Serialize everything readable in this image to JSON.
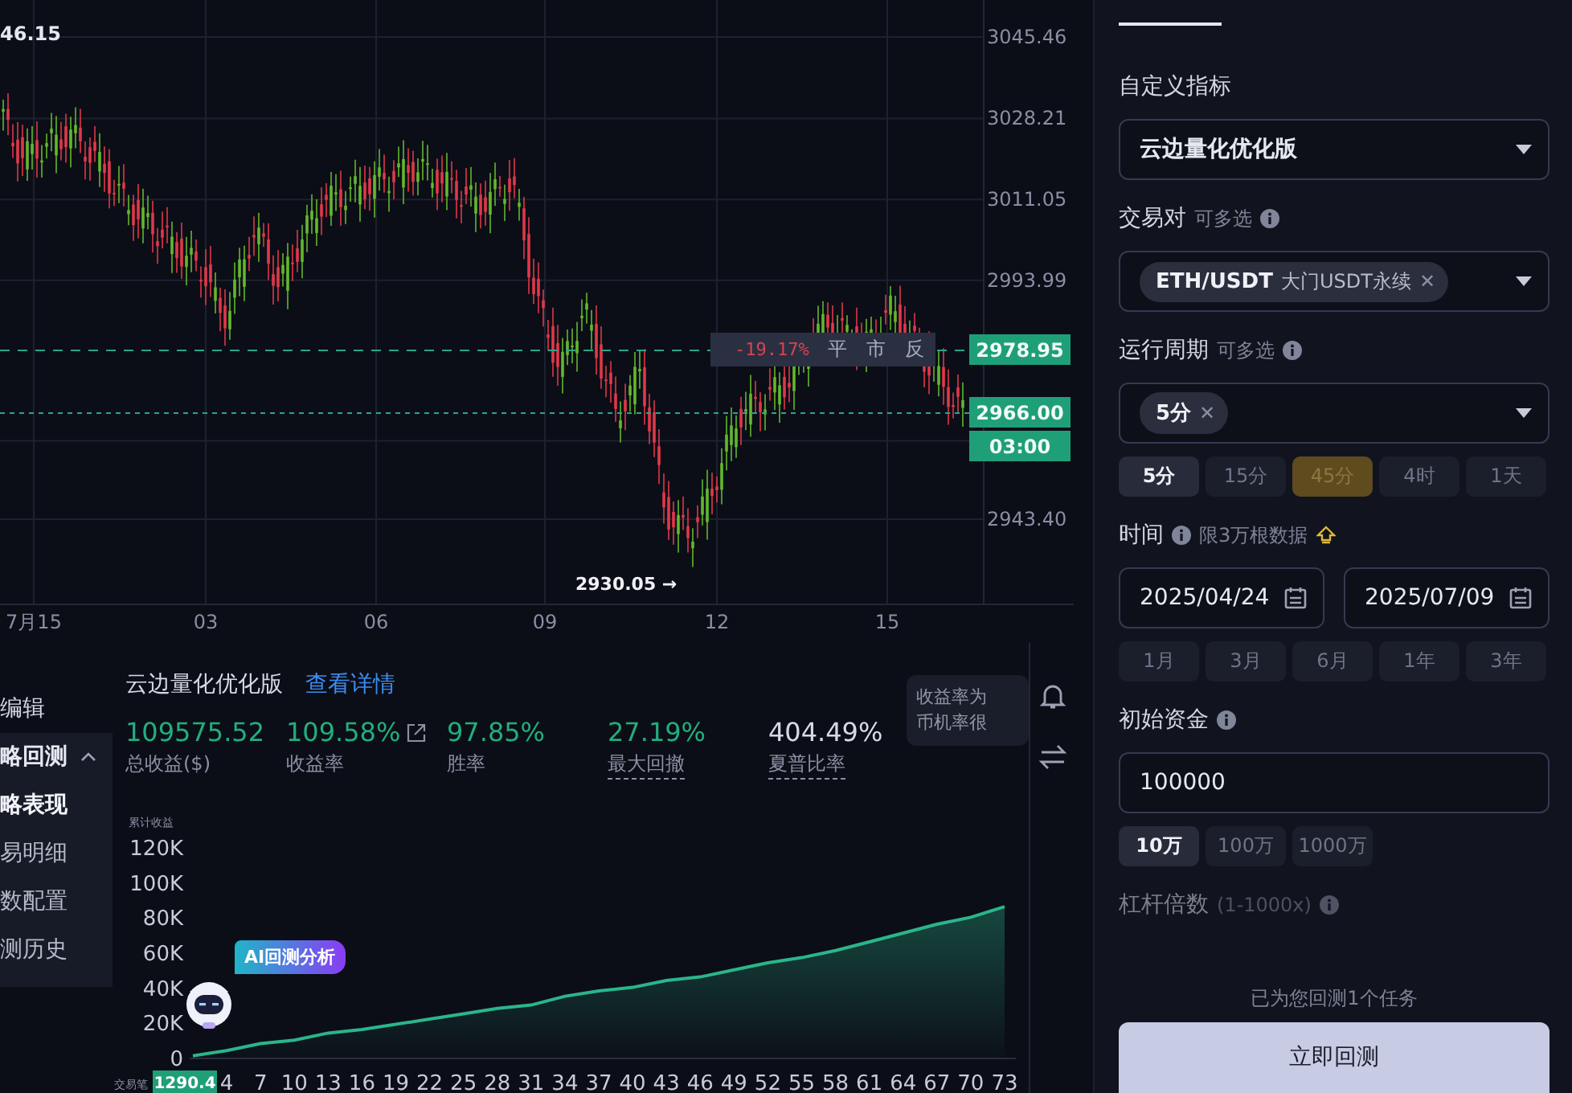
{
  "price_chart": {
    "corner_label": "46.15",
    "price_axis": [
      "3045.46",
      "3028.21",
      "3011.05",
      "2993.99",
      "2943.40"
    ],
    "date_axis": [
      "7月15",
      "03",
      "06",
      "09",
      "12",
      "15"
    ],
    "low_marker": "2930.05 →",
    "order_overlay": {
      "pnl": "-19.17%",
      "actions": [
        "平",
        "市",
        "反"
      ]
    },
    "price_badges": [
      "2978.95",
      "2966.00",
      "03:00"
    ]
  },
  "sidebar": {
    "items": [
      {
        "label": "编辑"
      },
      {
        "label": "略回测",
        "expanded": true,
        "children": [
          {
            "label": "略表现",
            "selected": true
          },
          {
            "label": "易明细",
            "selected": false
          },
          {
            "label": "数配置",
            "selected": false
          },
          {
            "label": "测历史",
            "selected": false
          }
        ]
      }
    ]
  },
  "results": {
    "title": "云边量化优化版",
    "link": "查看详情",
    "stats": [
      {
        "value": "109575.52",
        "label": "总收益($)",
        "color": "#24ad7e",
        "underlined": false,
        "has_icon": false
      },
      {
        "value": "109.58%",
        "label": "收益率",
        "color": "#24ad7e",
        "underlined": false,
        "has_icon": true
      },
      {
        "value": "97.85%",
        "label": "胜率",
        "color": "#24ad7e",
        "underlined": false,
        "has_icon": false
      },
      {
        "value": "27.19%",
        "label": "最大回撤",
        "color": "#24ad7e",
        "underlined": true,
        "has_icon": false
      },
      {
        "value": "404.49%",
        "label": "夏普比率",
        "color": "#d6d9e6",
        "underlined": true,
        "has_icon": false
      }
    ],
    "tooltip": [
      "收益率为",
      "币机率很"
    ],
    "ai_badge": "AI回测分析",
    "start_badge": "1290.4",
    "chart_data": {
      "type": "area",
      "ylabel": "累计收益",
      "xlabel": "交易笔",
      "x": [
        1,
        4,
        7,
        10,
        13,
        16,
        19,
        22,
        25,
        28,
        31,
        34,
        37,
        40,
        43,
        46,
        49,
        52,
        55,
        58,
        61,
        64,
        67,
        70,
        73
      ],
      "series": [
        {
          "color": "#2bb58a",
          "values": [
            1000,
            4000,
            8000,
            10000,
            14000,
            16000,
            19000,
            22000,
            25000,
            28000,
            30000,
            35000,
            38000,
            40000,
            44000,
            46000,
            50000,
            54000,
            57000,
            61000,
            66000,
            71000,
            76000,
            80000,
            86000
          ]
        }
      ],
      "xlim": [
        1,
        74
      ],
      "ylim": [
        0,
        120000
      ],
      "yticks": [
        {
          "value": 0,
          "label": "0"
        },
        {
          "value": 20000,
          "label": "20K"
        },
        {
          "value": 40000,
          "label": "40K"
        },
        {
          "value": 60000,
          "label": "60K"
        },
        {
          "value": 80000,
          "label": "80K"
        },
        {
          "value": 100000,
          "label": "100K"
        },
        {
          "value": 120000,
          "label": "120K"
        }
      ],
      "xticks": [
        4,
        7,
        10,
        13,
        16,
        19,
        22,
        25,
        28,
        31,
        34,
        37,
        40,
        43,
        46,
        49,
        52,
        55,
        58,
        61,
        64,
        67,
        70,
        73
      ]
    }
  },
  "form": {
    "indicator": {
      "label": "自定义指标",
      "value": "云边量化优化版"
    },
    "pair": {
      "label": "交易对",
      "hint": "可多选",
      "tags": [
        {
          "symbol": "ETH/USDT",
          "market": "大门USDT永续",
          "remove": "✕"
        }
      ]
    },
    "period": {
      "label": "运行周期",
      "hint": "可多选",
      "tags": [
        {
          "label": "5分",
          "remove": "✕"
        }
      ],
      "presets": [
        {
          "label": "5分",
          "selected": true,
          "kind": "normal"
        },
        {
          "label": "15分",
          "selected": false,
          "kind": "normal"
        },
        {
          "label": "45分",
          "selected": false,
          "kind": "premium"
        },
        {
          "label": "4时",
          "selected": false,
          "kind": "normal"
        },
        {
          "label": "1天",
          "selected": false,
          "kind": "normal"
        }
      ]
    },
    "time": {
      "label": "时间",
      "hint": "限3万根数据",
      "start": "2025/04/24",
      "end": "2025/07/09",
      "presets": [
        {
          "label": "1月",
          "selected": false
        },
        {
          "label": "3月",
          "selected": false
        },
        {
          "label": "6月",
          "selected": false
        },
        {
          "label": "1年",
          "selected": false
        },
        {
          "label": "3年",
          "selected": false
        }
      ]
    },
    "capital": {
      "label": "初始资金",
      "value": "100000",
      "presets": [
        {
          "label": "10万",
          "selected": true
        },
        {
          "label": "100万",
          "selected": false
        },
        {
          "label": "1000万",
          "selected": false
        }
      ]
    },
    "leverage": {
      "label": "杠杆倍数",
      "hint": "(1-1000x)"
    },
    "footer": {
      "note": "已为您回测1个任务",
      "button": "立即回测"
    }
  }
}
